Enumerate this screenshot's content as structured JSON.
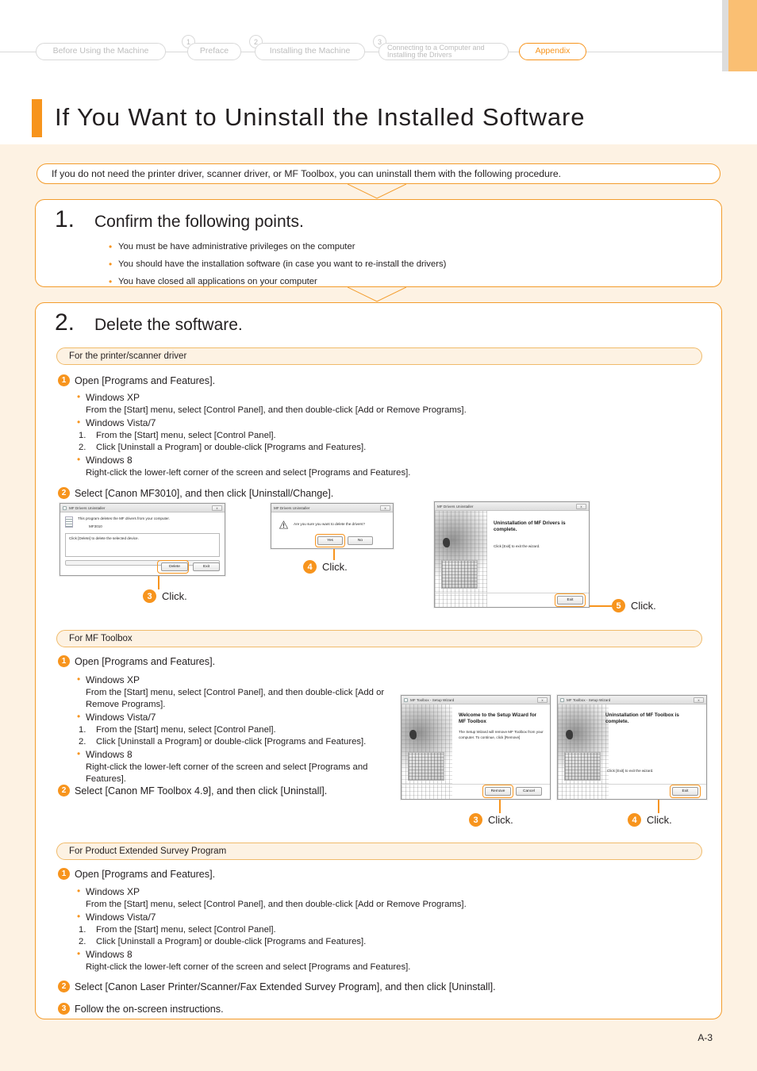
{
  "nav": {
    "tabs": [
      {
        "label": "Before Using the Machine",
        "num": null,
        "active": false
      },
      {
        "label": "Preface",
        "num": "1",
        "active": false
      },
      {
        "label": "Installing the Machine",
        "num": "2",
        "active": false
      },
      {
        "label": "Connecting to a Computer and",
        "label2": "Installing the Drivers",
        "num": "3",
        "active": false
      },
      {
        "label": "Appendix",
        "num": null,
        "active": true
      }
    ]
  },
  "page_title": "If You Want to Uninstall the Installed Software",
  "intro": "If you do not need the printer driver, scanner driver, or MF Toolbox, you can uninstall them with the following procedure.",
  "step1": {
    "number": "1.",
    "title": "Confirm the following points.",
    "bullets": [
      "You must be have administrative privileges on the computer",
      "You should have the installation software (in case you want to re-install the drivers)",
      "You have closed all applications on your computer"
    ]
  },
  "step2": {
    "number": "2.",
    "title": "Delete the software.",
    "sections": [
      {
        "heading": "For the printer/scanner driver",
        "step1_label": "Open [Programs and Features].",
        "os": [
          {
            "name": "Windows XP",
            "body": "From the [Start] menu, select [Control Panel], and then double-click [Add or Remove Programs]."
          },
          {
            "name": "Windows Vista/7",
            "ol": [
              "From the [Start] menu, select [Control Panel].",
              "Click [Uninstall a Program] or double-click [Programs and Features]."
            ]
          },
          {
            "name": "Windows 8",
            "body": "Right-click the lower-left corner of the screen and select [Programs and Features]."
          }
        ],
        "step2_label": "Select [Canon MF3010], and then click [Uninstall/Change]."
      },
      {
        "heading": "For MF Toolbox",
        "step1_label": "Open [Programs and Features].",
        "os": [
          {
            "name": "Windows XP",
            "body": "From the [Start] menu, select [Control Panel], and then double-click [Add or Remove Programs]."
          },
          {
            "name": "Windows Vista/7",
            "ol": [
              "From the [Start] menu, select [Control Panel].",
              "Click [Uninstall a Program] or double-click [Programs and Features]."
            ]
          },
          {
            "name": "Windows 8",
            "body": "Right-click the lower-left corner of the screen and select [Programs and Features]."
          }
        ],
        "step2_label": "Select [Canon MF Toolbox 4.9], and then click [Uninstall]."
      },
      {
        "heading": "For Product Extended Survey Program",
        "step1_label": "Open [Programs and Features].",
        "os": [
          {
            "name": "Windows XP",
            "body": "From the [Start] menu, select [Control Panel], and then double-click [Add or Remove Programs]."
          },
          {
            "name": "Windows Vista/7",
            "ol": [
              "From the [Start] menu, select [Control Panel].",
              "Click [Uninstall a Program] or double-click [Programs and Features]."
            ]
          },
          {
            "name": "Windows 8",
            "body": "Right-click the lower-left corner of the screen and select [Programs and Features]."
          }
        ],
        "step2_label": "Select [Canon Laser Printer/Scanner/Fax Extended Survey Program], and then click [Uninstall].",
        "step3_label": "Follow the on-screen instructions."
      }
    ]
  },
  "dialogs": {
    "driver_uninstaller": {
      "title": "MF Drivers Uninstaller",
      "close_label": "x",
      "line1": "This program deletes the MF drivers from your computer.",
      "device": "MF3010",
      "field_text": "Click [Delete] to delete the selected device.",
      "btn_delete": "Delete",
      "btn_exit": "Exit"
    },
    "confirm": {
      "title": "MF Drivers Uninstaller",
      "close_label": "x",
      "message": "Are you sure you want to delete the drivers?",
      "btn_yes": "Yes",
      "btn_no": "No"
    },
    "driver_complete": {
      "title": "MF Drivers Uninstaller",
      "close_label": "x",
      "heading": "Uninstallation of MF Drivers is complete.",
      "body": "Click [Exit] to exit the wizard.",
      "btn_exit": "Exit"
    },
    "toolbox_welcome": {
      "title": "MF Toolbox - Setup Wizard",
      "close_label": "x",
      "heading": "Welcome to the Setup Wizard for MF Toolbox",
      "body": "The Setup Wizard will remove MF Toolbox from your computer. To continue, click [Remove]",
      "btn_remove": "Remove",
      "btn_cancel": "Cancel"
    },
    "toolbox_complete": {
      "title": "MF Toolbox - Setup Wizard",
      "close_label": "x",
      "heading": "Uninstallation of MF Toolbox is complete.",
      "body": "Click [Exit] to exit the wizard.",
      "btn_exit": "Exit"
    }
  },
  "callouts": {
    "c3": {
      "num": "3",
      "label": "Click."
    },
    "c4": {
      "num": "4",
      "label": "Click."
    },
    "c5": {
      "num": "5",
      "label": "Click."
    },
    "t3": {
      "num": "3",
      "label": "Click."
    },
    "t4": {
      "num": "4",
      "label": "Click."
    }
  },
  "page_number": "A-3",
  "colors": {
    "accent": "#f7941d",
    "accent_light": "#fabf73",
    "page_bg": "#fdf2e3"
  }
}
